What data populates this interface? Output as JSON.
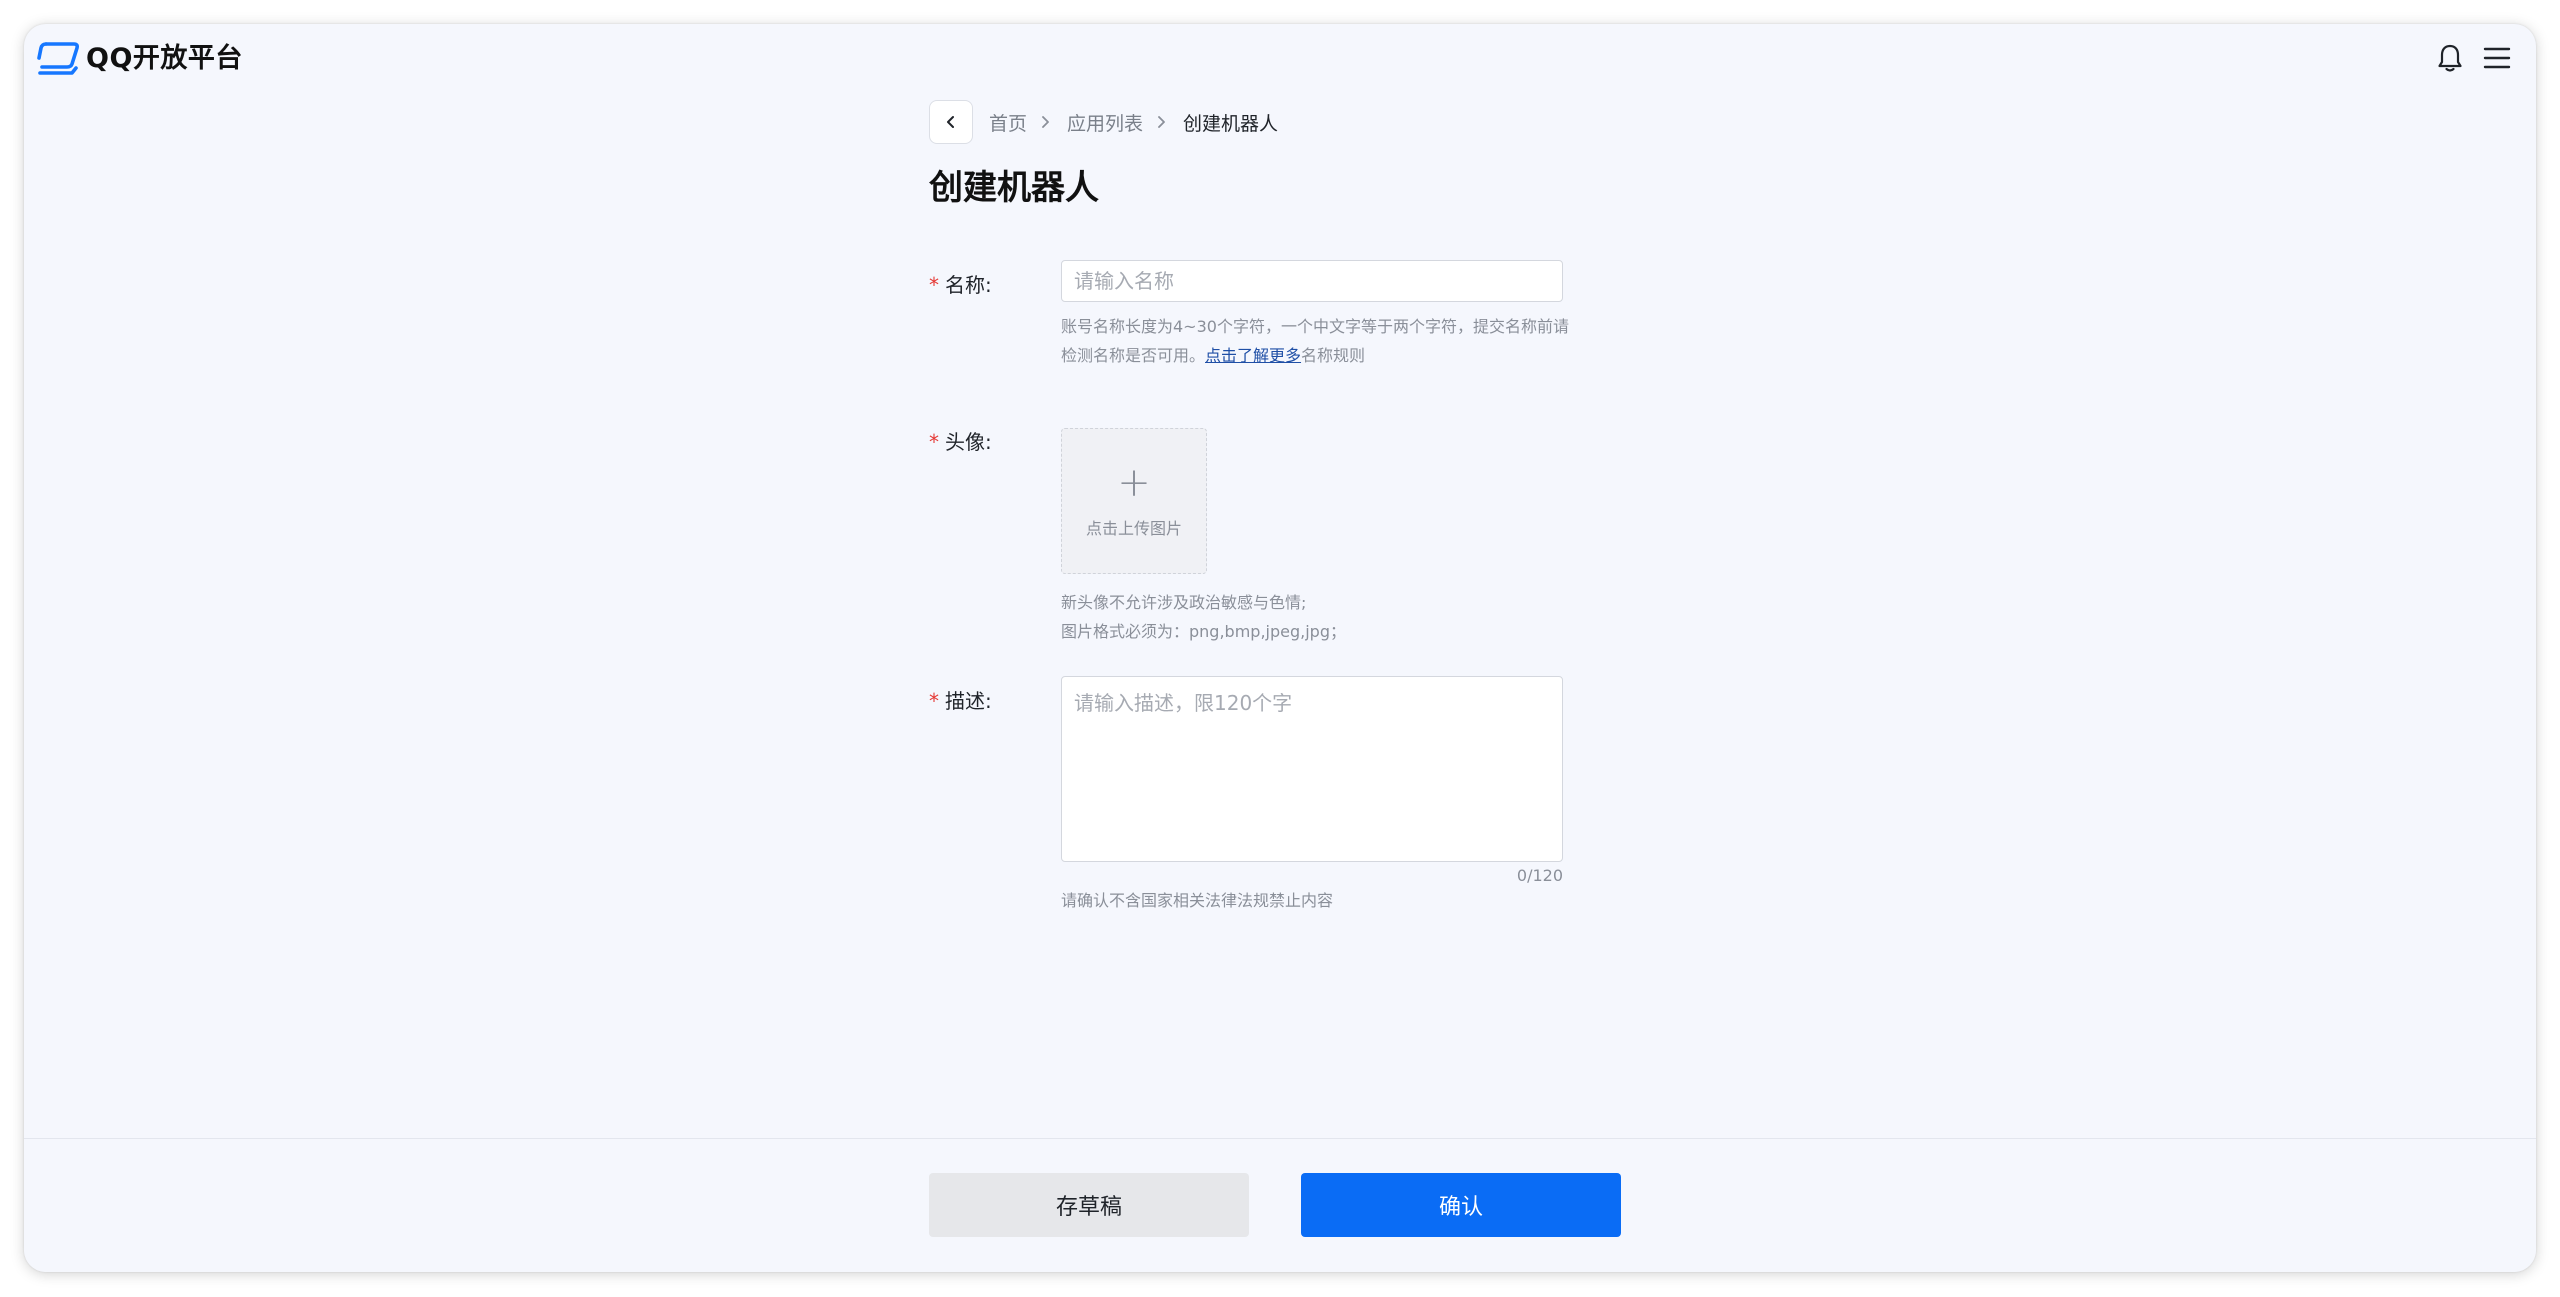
{
  "app": {
    "logo_text": "QQ开放平台",
    "icons": {
      "logo": "qq-open-platform-logo",
      "notifications": "bell-icon",
      "menu": "hamburger-menu-icon"
    }
  },
  "breadcrumb": {
    "items": [
      "首页",
      "应用列表",
      "创建机器人"
    ]
  },
  "page": {
    "title": "创建机器人"
  },
  "form": {
    "name": {
      "required_mark": "*",
      "label": "名称:",
      "placeholder": "请输入名称",
      "hint_line1": "账号名称长度为4~30个字符，一个中文字等于两个字符，提交名称前请",
      "hint_line2_prefix": "检测名称是否可用。",
      "hint_link": "点击了解更多",
      "hint_line2_suffix": "名称规则"
    },
    "avatar": {
      "required_mark": "*",
      "label": "头像:",
      "upload_icon": "+",
      "upload_text": "点击上传图片",
      "hint_line1": "新头像不允许涉及政治敏感与色情;",
      "hint_line2": "图片格式必须为：png,bmp,jpeg,jpg；"
    },
    "description": {
      "required_mark": "*",
      "label": "描述:",
      "placeholder": "请输入描述，限120个字",
      "counter": "0/120",
      "hint": "请确认不含国家相关法律法规禁止内容"
    }
  },
  "footer": {
    "draft_label": "存草稿",
    "confirm_label": "确认"
  },
  "colors": {
    "primary": "#0a6cf5",
    "required": "#e53935",
    "link": "#1f4fa6",
    "background": "#f5f7fd"
  }
}
